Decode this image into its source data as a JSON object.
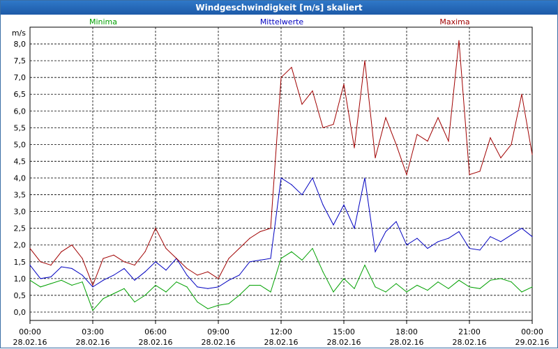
{
  "window": {
    "title": "Windgeschwindigkeit [m/s] skaliert"
  },
  "colors": {
    "minima": "#00a000",
    "mittelwerte": "#0000c0",
    "maxima": "#a00000",
    "grid": "#000000"
  },
  "chart_data": {
    "type": "line",
    "title": "Windgeschwindigkeit [m/s] skaliert",
    "ylabel": "m/s",
    "xlabel": "",
    "ylim": [
      -0.25,
      8.5
    ],
    "xlim": [
      0,
      24
    ],
    "grid": true,
    "legend": "top",
    "yticks": [
      "0,0",
      "0,5",
      "1,0",
      "1,5",
      "2,0",
      "2,5",
      "3,0",
      "3,5",
      "4,0",
      "4,5",
      "5,0",
      "5,5",
      "6,0",
      "6,5",
      "7,0",
      "7,5",
      "8,0"
    ],
    "xticks": [
      {
        "time": "00:00",
        "date": "28.02.16"
      },
      {
        "time": "03:00",
        "date": "28.02.16"
      },
      {
        "time": "06:00",
        "date": "28.02.16"
      },
      {
        "time": "09:00",
        "date": "28.02.16"
      },
      {
        "time": "12:00",
        "date": "28.02.16"
      },
      {
        "time": "15:00",
        "date": "28.02.16"
      },
      {
        "time": "18:00",
        "date": "28.02.16"
      },
      {
        "time": "21:00",
        "date": "28.02.16"
      },
      {
        "time": "00:00",
        "date": "29.02.16"
      }
    ],
    "x_hours": [
      0,
      0.5,
      1,
      1.5,
      2,
      2.5,
      3,
      3.5,
      4,
      4.5,
      5,
      5.5,
      6,
      6.5,
      7,
      7.5,
      8,
      8.5,
      9,
      9.5,
      10,
      10.5,
      11,
      11.5,
      12,
      12.5,
      13,
      13.5,
      14,
      14.5,
      15,
      15.5,
      16,
      16.5,
      17,
      17.5,
      18,
      18.5,
      19,
      19.5,
      20,
      20.5,
      21,
      21.5,
      22,
      22.5,
      23,
      23.5,
      24
    ],
    "series": [
      {
        "name": "Minima",
        "key": "minima",
        "values": [
          0.95,
          0.75,
          0.85,
          0.95,
          0.8,
          0.9,
          0.05,
          0.4,
          0.55,
          0.7,
          0.3,
          0.5,
          0.8,
          0.6,
          0.9,
          0.75,
          0.3,
          0.1,
          0.2,
          0.25,
          0.5,
          0.8,
          0.8,
          0.6,
          1.6,
          1.8,
          1.55,
          1.9,
          1.2,
          0.6,
          1.0,
          0.7,
          1.4,
          0.75,
          0.6,
          0.85,
          0.6,
          0.8,
          0.65,
          0.9,
          0.7,
          0.95,
          0.75,
          0.7,
          0.95,
          1.0,
          0.9,
          0.6,
          0.75
        ]
      },
      {
        "name": "Mittelwerte",
        "key": "mittelwerte",
        "values": [
          1.4,
          1.0,
          1.05,
          1.35,
          1.3,
          1.1,
          0.75,
          0.95,
          1.1,
          1.3,
          0.95,
          1.2,
          1.5,
          1.25,
          1.6,
          1.1,
          0.75,
          0.7,
          0.75,
          0.95,
          1.1,
          1.5,
          1.55,
          1.6,
          4.0,
          3.8,
          3.5,
          4.0,
          3.2,
          2.6,
          3.2,
          2.5,
          4.0,
          1.8,
          2.4,
          2.7,
          2.0,
          2.2,
          1.9,
          2.1,
          2.2,
          2.4,
          1.9,
          1.85,
          2.25,
          2.1,
          2.3,
          2.5,
          2.25
        ]
      },
      {
        "name": "Maxima",
        "key": "maxima",
        "values": [
          1.9,
          1.5,
          1.4,
          1.8,
          2.0,
          1.6,
          0.8,
          1.6,
          1.7,
          1.5,
          1.4,
          1.8,
          2.5,
          1.9,
          1.6,
          1.3,
          1.1,
          1.2,
          1.0,
          1.6,
          1.9,
          2.2,
          2.4,
          2.5,
          7.0,
          7.3,
          6.2,
          6.6,
          5.5,
          5.6,
          6.8,
          4.9,
          7.5,
          4.6,
          5.8,
          5.0,
          4.1,
          5.3,
          5.1,
          5.8,
          5.1,
          8.1,
          4.1,
          4.2,
          5.2,
          4.6,
          5.0,
          6.5,
          4.7
        ]
      }
    ]
  }
}
